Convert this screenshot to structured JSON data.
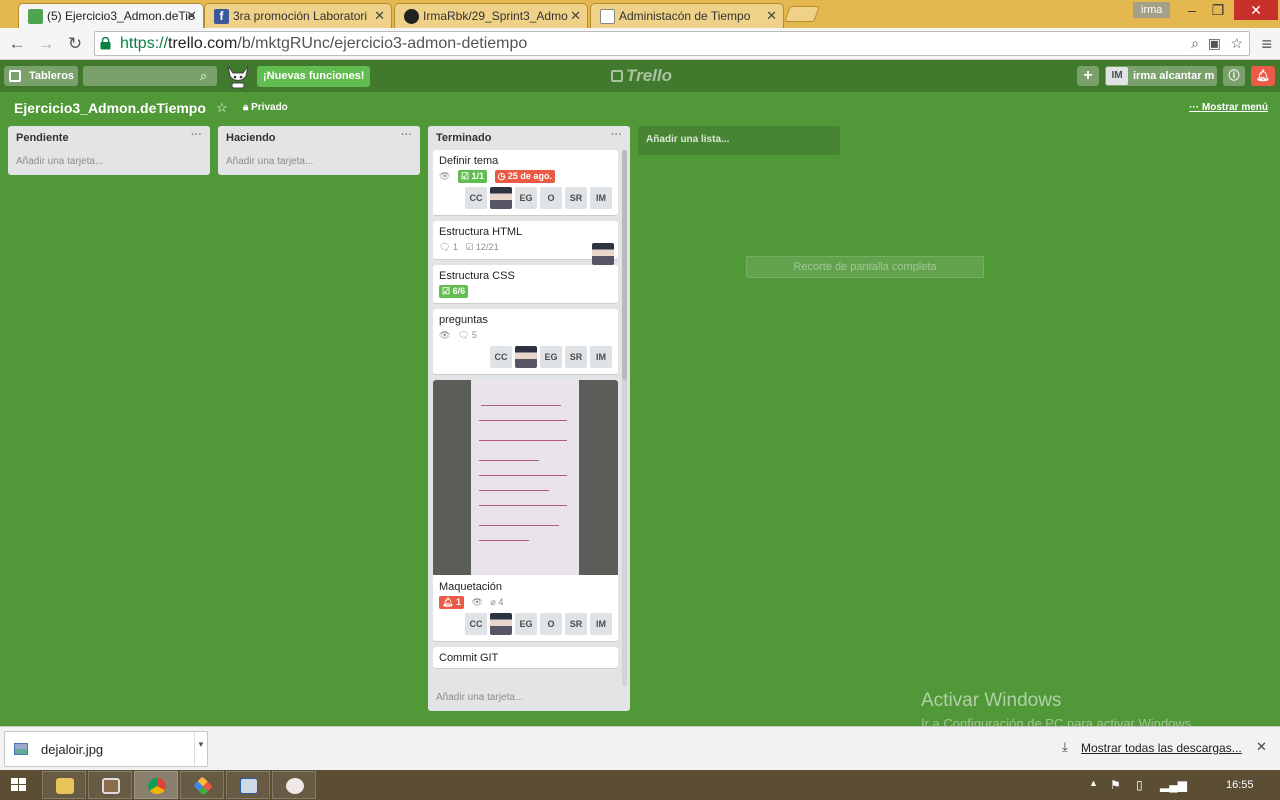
{
  "browser": {
    "tabs": [
      {
        "title": "(5) Ejercicio3_Admon.deTie",
        "icon": "trello-favicon",
        "active": true
      },
      {
        "title": "3ra promoción Laboratori",
        "icon": "facebook-favicon",
        "active": false
      },
      {
        "title": "IrmaRbk/29_Sprint3_Admo",
        "icon": "github-favicon",
        "active": false
      },
      {
        "title": "Administacón de Tiempo",
        "icon": "page-favicon",
        "active": false
      }
    ],
    "profile_name": "irma",
    "url_scheme": "https://",
    "url_host": "trello.com",
    "url_path": "/b/mktgRUnc/ejercicio3-admon-detiempo"
  },
  "header": {
    "boards_label": "Tableros",
    "search_value": "",
    "new_features_label": "¡Nuevas funciones!",
    "logo_text": "Trello",
    "member_initials": "IM",
    "member_name": "irma alcantar m"
  },
  "board": {
    "title": "Ejercicio3_Admon.deTiempo",
    "visibility": "Privado",
    "show_menu_label": "Mostrar menú"
  },
  "lists": [
    {
      "name": "Pendiente",
      "menu": "···",
      "add_card": "Añadir una tarjeta..."
    },
    {
      "name": "Haciendo",
      "menu": "···",
      "add_card": "Añadir una tarjeta..."
    },
    {
      "name": "Terminado",
      "menu": "···",
      "add_card": "Añadir una tarjeta..."
    }
  ],
  "cards": {
    "c1": {
      "title": "Definir tema",
      "checklist": "1/1",
      "due": "25 de ago.",
      "members": [
        "CC",
        "photo",
        "EG",
        "O",
        "SR",
        "IM"
      ]
    },
    "c2": {
      "title": "Estructura HTML",
      "comments": "1",
      "checklist": "12/21"
    },
    "c3": {
      "title": "Estructura CSS",
      "checklist": "6/6"
    },
    "c4": {
      "title": "preguntas",
      "comments": "5",
      "members": [
        "CC",
        "photo",
        "EG",
        "SR",
        "IM"
      ]
    },
    "c5": {
      "title": "Maquetación",
      "notifications": "1",
      "attachments": "4",
      "members": [
        "CC",
        "photo",
        "EG",
        "O",
        "SR",
        "IM"
      ]
    },
    "c6": {
      "title": "Commit GIT"
    }
  },
  "add_list_label": "Añadir una lista...",
  "snip_label": "Recorte de pantalla completa",
  "watermark": {
    "title": "Activar Windows",
    "subtitle": "Ir a Configuración de PC para activar Windows."
  },
  "downloads": {
    "file_name": "dejaloir.jpg",
    "show_all_label": "Mostrar todas las descargas..."
  },
  "taskbar": {
    "clock": "16:55"
  },
  "colors": {
    "board_bg": "#519839",
    "header_bg": "#41792d",
    "green_badge": "#61bd4f",
    "red_badge": "#eb5a46"
  }
}
